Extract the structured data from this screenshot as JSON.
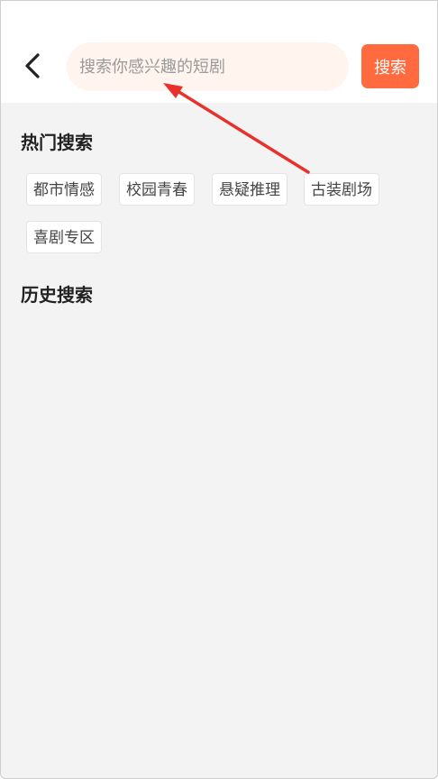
{
  "search": {
    "placeholder": "搜索你感兴趣的短剧",
    "button_label": "搜索",
    "back_icon": "chevron-left-icon"
  },
  "hot_search": {
    "title": "热门搜索",
    "tags": [
      "都市情感",
      "校园青春",
      "悬疑推理",
      "古装剧场",
      "喜剧专区"
    ]
  },
  "history_search": {
    "title": "历史搜索"
  },
  "colors": {
    "accent": "#ff6a3f",
    "search_box_bg": "#fff4ee",
    "page_bg": "#f3f3f3",
    "annotation_arrow": "#e8312a"
  }
}
